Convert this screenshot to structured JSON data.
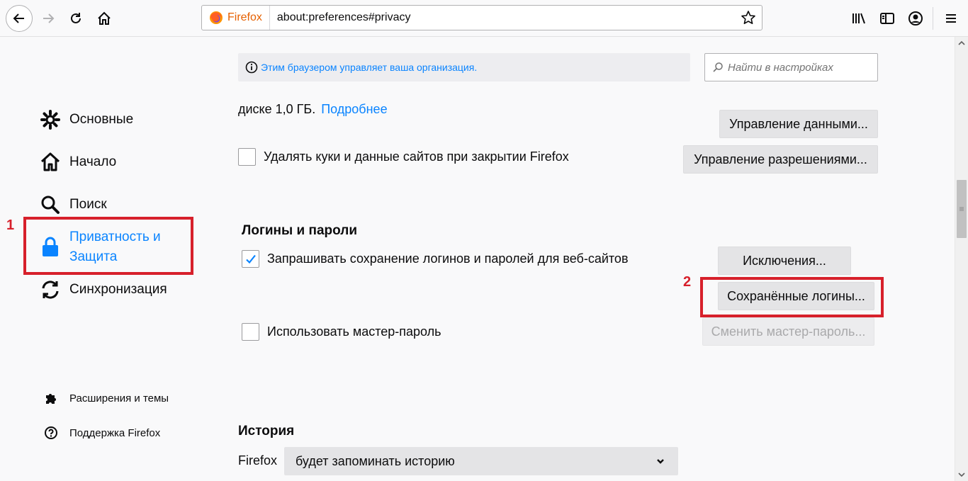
{
  "toolbar": {
    "identity_label": "Firefox",
    "url": "about:preferences#privacy"
  },
  "sidebar": {
    "items": [
      {
        "label": "Основные",
        "icon": "gear-icon"
      },
      {
        "label": "Начало",
        "icon": "home-icon"
      },
      {
        "label": "Поиск",
        "icon": "search-icon"
      },
      {
        "label": "Приватность и Защита",
        "label_line1": "Приватность и",
        "label_line2": "Защита",
        "icon": "lock-icon",
        "selected": true
      },
      {
        "label": "Синхронизация",
        "icon": "sync-icon"
      }
    ],
    "footer": [
      {
        "label": "Расширения и темы",
        "icon": "puzzle-icon"
      },
      {
        "label": "Поддержка Firefox",
        "icon": "help-icon"
      }
    ]
  },
  "annotations": {
    "marker1": "1",
    "marker2": "2",
    "color": "#d7202b"
  },
  "main": {
    "policy_notice": "Этим браузером управляет ваша организация.",
    "search_placeholder": "Найти в настройках",
    "cut_text": "диске 1,0 ГБ.",
    "cut_link": "Подробнее",
    "manage_data_button": "Управление данными...",
    "manage_permissions_button": "Управление разрешениями...",
    "delete_cookies_label": "Удалять куки и данные сайтов при закрытии Firefox",
    "delete_cookies_checked": false,
    "logins_heading": "Логины и пароли",
    "ask_save_logins_label": "Запрашивать сохранение логинов и паролей для веб-сайтов",
    "ask_save_logins_checked": true,
    "exceptions_button": "Исключения...",
    "saved_logins_button": "Сохранённые логины...",
    "master_password_label": "Использовать мастер-пароль",
    "master_password_checked": false,
    "change_master_password_button": "Сменить мастер-пароль...",
    "history_heading": "История",
    "history_prefix": "Firefox",
    "history_select_value": "будет запоминать историю"
  },
  "colors": {
    "accent": "#0a84ff",
    "identity": "#e66000"
  }
}
